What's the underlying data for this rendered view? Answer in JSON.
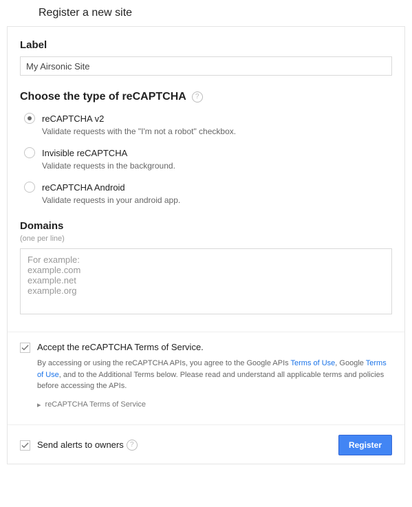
{
  "page_title": "Register a new site",
  "label_section": {
    "heading": "Label",
    "value": "My Airsonic Site"
  },
  "type_section": {
    "heading": "Choose the type of reCAPTCHA",
    "options": [
      {
        "label": "reCAPTCHA v2",
        "desc": "Validate requests with the \"I'm not a robot\" checkbox.",
        "selected": true
      },
      {
        "label": "Invisible reCAPTCHA",
        "desc": "Validate requests in the background.",
        "selected": false
      },
      {
        "label": "reCAPTCHA Android",
        "desc": "Validate requests in your android app.",
        "selected": false
      }
    ]
  },
  "domains_section": {
    "heading": "Domains",
    "hint": "(one per line)",
    "placeholder": "For example:\n example.com\n example.net\n example.org",
    "value": ""
  },
  "terms_section": {
    "checkbox_label": "Accept the reCAPTCHA Terms of Service.",
    "checked": true,
    "desc_prefix": "By accessing or using the reCAPTCHA APIs, you agree to the Google APIs ",
    "link1": "Terms of Use",
    "desc_mid1": ", Google ",
    "link2": "Terms of Use",
    "desc_suffix": ", and to the Additional Terms below. Please read and understand all applicable terms and policies before accessing the APIs.",
    "collapsed_label": "reCAPTCHA Terms of Service"
  },
  "alerts_section": {
    "checkbox_label": "Send alerts to owners",
    "checked": true
  },
  "buttons": {
    "register": "Register"
  }
}
